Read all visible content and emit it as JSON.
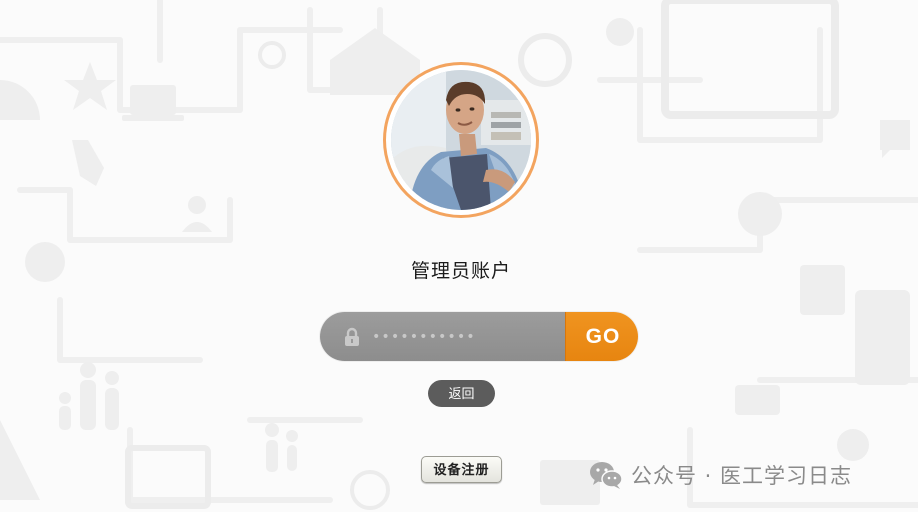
{
  "account": {
    "title": "管理员账户"
  },
  "login": {
    "password_mask": "•••••••••••",
    "go_label": "GO"
  },
  "actions": {
    "back_label": "返回",
    "register_label": "设备注册"
  },
  "watermark": {
    "text": "公众号 · 医工学习日志"
  },
  "icons": {
    "lock": "lock-icon",
    "avatar": "user-photo",
    "wechat": "wechat-icon"
  },
  "colors": {
    "accent": "#ef8f1c",
    "avatar_ring": "#f3a45f",
    "password_bg": "#969696",
    "back_button_bg": "#5c5c5c",
    "background": "#fbfbfb"
  }
}
